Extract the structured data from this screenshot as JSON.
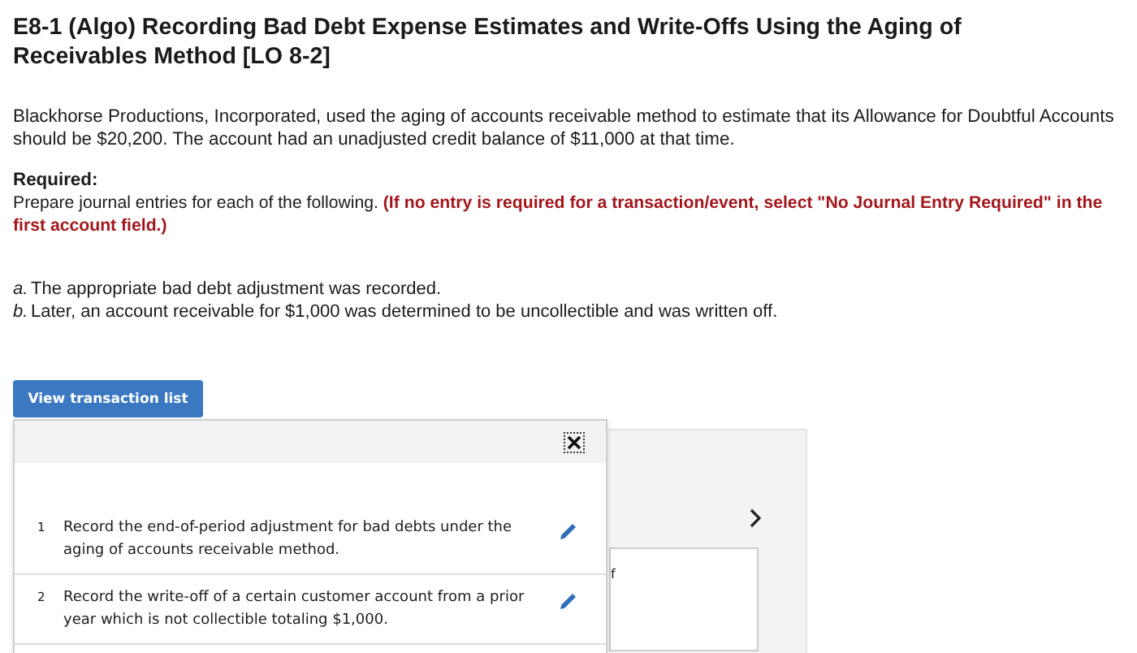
{
  "title": "E8-1 (Algo) Recording Bad Debt Expense Estimates and Write-Offs Using the Aging of Receivables Method [LO 8-2]",
  "intro": "Blackhorse Productions, Incorporated, used the aging of accounts receivable method to estimate that its Allowance for Doubtful Accounts should be $20,200. The account had an unadjusted credit balance of $11,000 at that time.",
  "required_label": "Required:",
  "instruction": "Prepare journal entries for each of the following. **(If no entry is required for a transaction/event, select \"No Journal Entry Required\" in the first account field.)**",
  "items": [
    {
      "marker": "a.",
      "text": "The appropriate bad debt adjustment was recorded."
    },
    {
      "marker": "b.",
      "text": "Later, an account receivable for $1,000 was determined to be uncollectible and was written off."
    }
  ],
  "view_button": "View transaction list",
  "transaction_popup": {
    "transactions": [
      {
        "number": "1",
        "text": "Record the end-of-period adjustment for bad debts under the aging of accounts receivable method."
      },
      {
        "number": "2",
        "text": "Record the write-off of a certain customer account from a prior year which is not collectible totaling $1,000."
      }
    ]
  },
  "background_panel": {
    "fragment": "f"
  }
}
